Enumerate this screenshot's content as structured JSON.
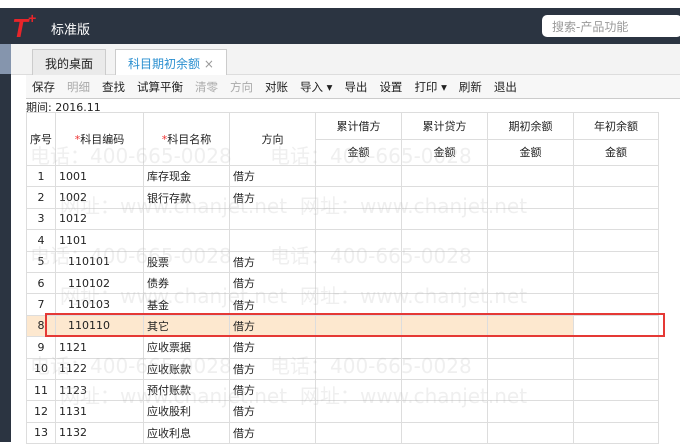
{
  "app": {
    "logo": "T",
    "logo_plus": "+",
    "edition": "标准版",
    "search_placeholder": "搜索-产品功能"
  },
  "tabs": [
    {
      "label": "我的桌面"
    },
    {
      "label": "科目期初余额",
      "close": "×"
    }
  ],
  "toolbar": [
    {
      "label": "保存",
      "enabled": true
    },
    {
      "label": "明细",
      "enabled": false
    },
    {
      "label": "查找",
      "enabled": true
    },
    {
      "label": "试算平衡",
      "enabled": true
    },
    {
      "label": "清零",
      "enabled": false
    },
    {
      "label": "方向",
      "enabled": false
    },
    {
      "label": "对账",
      "enabled": true
    },
    {
      "label": "导入 ▾",
      "enabled": true
    },
    {
      "label": "导出",
      "enabled": true
    },
    {
      "label": "设置",
      "enabled": true
    },
    {
      "label": "打印 ▾",
      "enabled": true
    },
    {
      "label": "刷新",
      "enabled": true
    },
    {
      "label": "退出",
      "enabled": true
    }
  ],
  "period": {
    "label": "期间:",
    "value": "2016.11"
  },
  "table": {
    "headers": {
      "seq": "序号",
      "code": "科目编码",
      "name": "科目名称",
      "dir": "方向",
      "debit": "累计借方",
      "credit": "累计贷方",
      "opening": "期初余额",
      "year": "年初余额",
      "amount": "金额",
      "req": "*"
    },
    "rows": [
      {
        "seq": "1",
        "code": "1001",
        "name": "库存现金",
        "dir": "借方"
      },
      {
        "seq": "2",
        "code": "1002",
        "name": "银行存款",
        "dir": "借方"
      },
      {
        "seq": "3",
        "code": "1012",
        "name": "",
        "dir": ""
      },
      {
        "seq": "4",
        "code": "1101",
        "name": "",
        "dir": ""
      },
      {
        "seq": "5",
        "code": "110101",
        "name": "股票",
        "dir": "借方"
      },
      {
        "seq": "6",
        "code": "110102",
        "name": "债券",
        "dir": "借方"
      },
      {
        "seq": "7",
        "code": "110103",
        "name": "基金",
        "dir": "借方"
      },
      {
        "seq": "8",
        "code": "110110",
        "name": "其它",
        "dir": "借方"
      },
      {
        "seq": "9",
        "code": "1121",
        "name": "应收票据",
        "dir": "借方"
      },
      {
        "seq": "10",
        "code": "1122",
        "name": "应收账款",
        "dir": "借方"
      },
      {
        "seq": "11",
        "code": "1123",
        "name": "预付账款",
        "dir": "借方"
      },
      {
        "seq": "12",
        "code": "1131",
        "name": "应收股利",
        "dir": "借方"
      },
      {
        "seq": "13",
        "code": "1132",
        "name": "应收利息",
        "dir": "借方"
      }
    ]
  },
  "watermark": {
    "phone": "电话：400-665-0028",
    "site": "网址：www.chanjet.net"
  }
}
